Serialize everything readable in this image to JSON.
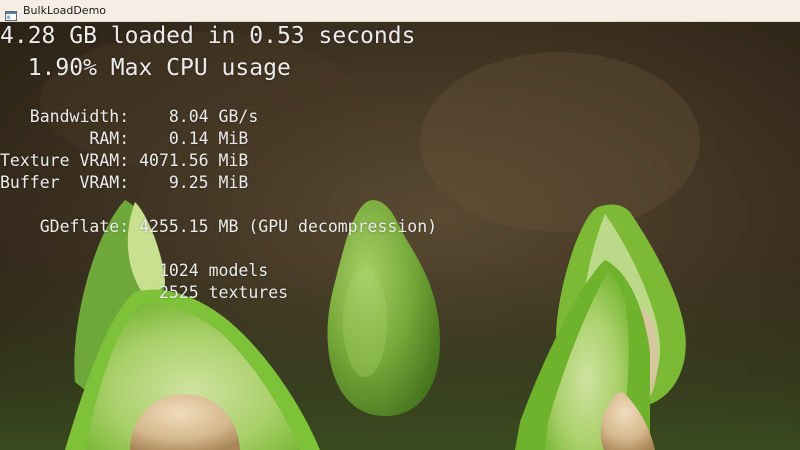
{
  "window": {
    "title": "BulkLoadDemo",
    "icon": "app-window-icon"
  },
  "hud": {
    "line1": "4.28 GB loaded in 0.53 seconds",
    "line2": "  1.90% Max CPU usage",
    "bandwidth": "   Bandwidth:    8.04 GB/s",
    "ram": "         RAM:    0.14 MiB",
    "texture_vram": "Texture VRAM: 4071.56 MiB",
    "buffer_vram": "Buffer  VRAM:    9.25 MiB",
    "gdeflate": "    GDeflate: 4255.15 MB (GPU decompression)",
    "models": "                1024 models",
    "textures": "                2525 textures"
  },
  "colors": {
    "hud_text": "#ececec",
    "titlebar_bg": "#f6eee4",
    "background_dark": "#2b2216",
    "avocado_green": "#7fbf3a",
    "avocado_skin": "#5e9a24",
    "seed": "#d8bd98"
  }
}
